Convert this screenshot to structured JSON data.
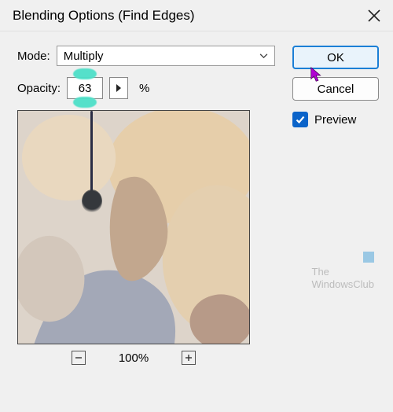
{
  "dialog": {
    "title": "Blending Options (Find Edges)"
  },
  "mode": {
    "label": "Mode:",
    "value": "Multiply"
  },
  "opacity": {
    "label": "Opacity:",
    "value": "63",
    "unit": "%"
  },
  "zoom": {
    "value": "100%"
  },
  "buttons": {
    "ok": "OK",
    "cancel": "Cancel"
  },
  "preview": {
    "label": "Preview",
    "checked": true
  },
  "watermark": {
    "line1": "The",
    "line2": "WindowsClub"
  }
}
